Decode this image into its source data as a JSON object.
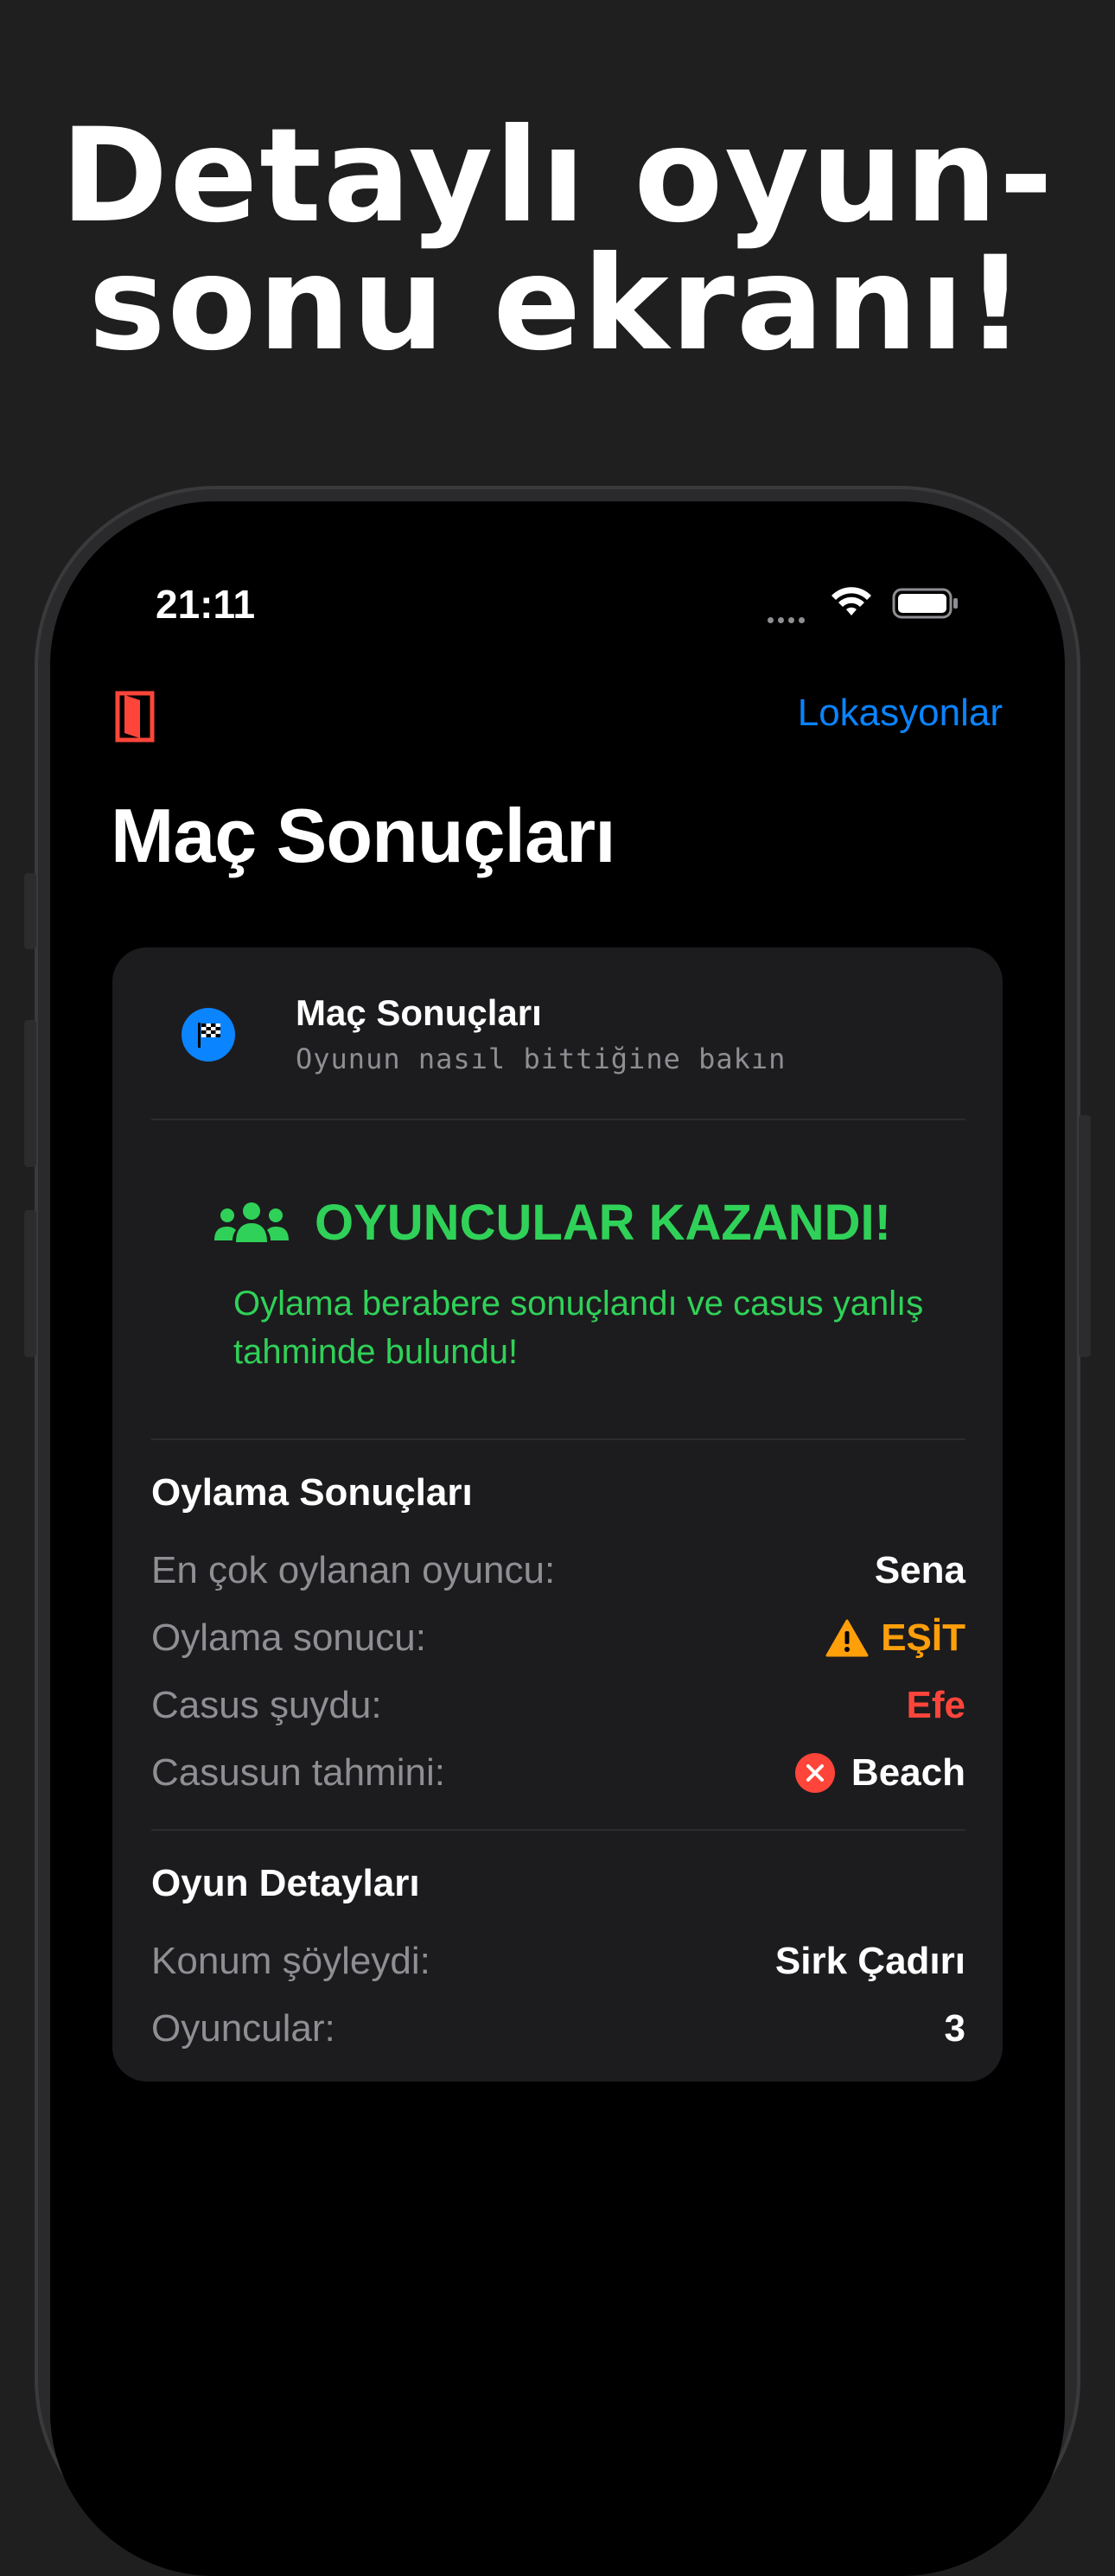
{
  "headline": {
    "line1": "Detaylı oyun-",
    "line2": "sonu ekranı!"
  },
  "status_bar": {
    "time": "21:11"
  },
  "nav": {
    "right_link": "Lokasyonlar"
  },
  "page_title": "Maç Sonuçları",
  "card": {
    "title": "Maç Sonuçları",
    "subtitle": "Oyunun nasıl bittiğine bakın",
    "result_title": "OYUNCULAR KAZANDI!",
    "result_description": "Oylama berabere sonuçlandı ve casus yanlış tahminde bulundu!",
    "voting_section": {
      "title": "Oylama Sonuçları",
      "rows": [
        {
          "label": "En çok oylanan oyuncu:",
          "value": "Sena"
        },
        {
          "label": "Oylama sonucu:",
          "value": "EŞİT"
        },
        {
          "label": "Casus şuydu:",
          "value": "Efe"
        },
        {
          "label": "Casusun tahmini:",
          "value": "Beach"
        }
      ]
    },
    "game_section": {
      "title": "Oyun Detayları",
      "rows": [
        {
          "label": "Konum şöyleydi:",
          "value": "Sirk Çadırı"
        },
        {
          "label": "Oyuncular:",
          "value": "3"
        }
      ]
    }
  },
  "colors": {
    "accent_blue": "#0a84ff",
    "success_green": "#30d158",
    "warning_orange": "#ff9f0a",
    "danger_red": "#ff453a"
  },
  "icons": {
    "exit": "door-icon",
    "header": "checkered-flag-icon",
    "result": "people-icon",
    "tie": "warning-triangle-icon",
    "wrong_guess": "x-circle-icon"
  }
}
